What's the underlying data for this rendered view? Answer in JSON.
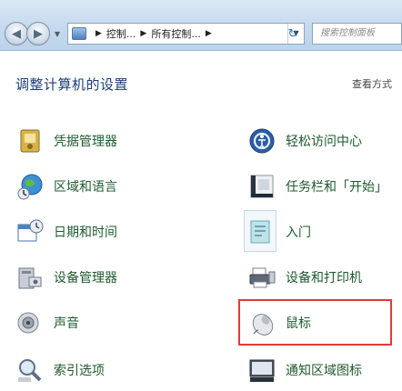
{
  "address_bar": {
    "path": [
      "控制...",
      "所有控制..."
    ],
    "search_placeholder": "搜索控制面板"
  },
  "header": {
    "title": "调整计算机的设置",
    "view_by": "查看方式"
  },
  "items_left": [
    {
      "label": "凭据管理器",
      "icon": "credential-manager-icon"
    },
    {
      "label": "区域和语言",
      "icon": "globe-icon"
    },
    {
      "label": "日期和时间",
      "icon": "calendar-clock-icon"
    },
    {
      "label": "设备管理器",
      "icon": "device-manager-icon"
    },
    {
      "label": "声音",
      "icon": "speaker-icon"
    },
    {
      "label": "索引选项",
      "icon": "magnifier-icon"
    }
  ],
  "items_right": [
    {
      "label": "轻松访问中心",
      "icon": "ease-of-access-icon"
    },
    {
      "label": "任务栏和「开始」",
      "icon": "taskbar-icon"
    },
    {
      "label": "入门",
      "icon": "getting-started-icon"
    },
    {
      "label": "设备和打印机",
      "icon": "printer-icon"
    },
    {
      "label": "鼠标",
      "icon": "mouse-icon"
    },
    {
      "label": "通知区域图标",
      "icon": "notification-area-icon"
    }
  ],
  "colors": {
    "link_green": "#1e5a2e",
    "title_blue": "#1b3c7a",
    "highlight_red": "#e03a3a"
  }
}
